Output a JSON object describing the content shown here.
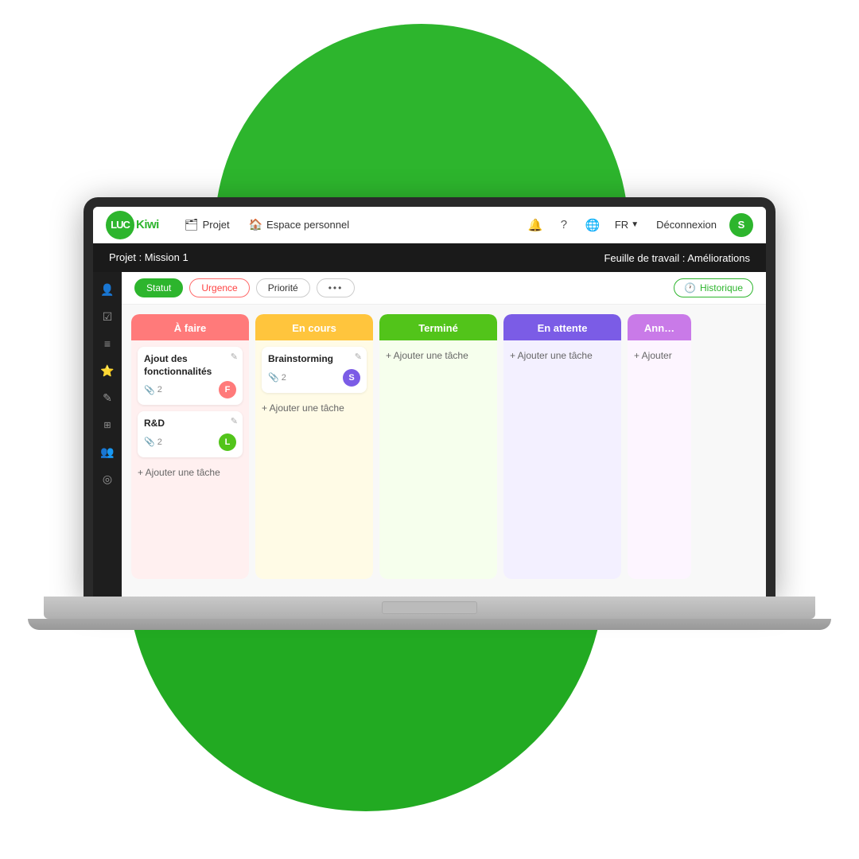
{
  "scene": {
    "logo": {
      "text_luc": "LUC",
      "text_kiwi": "Kiwi",
      "full": "LUCKiwi"
    },
    "navbar": {
      "projet_label": "Projet",
      "espace_label": "Espace personnel",
      "lang": "FR",
      "deconnexion": "Déconnexion",
      "user_initial": "S"
    },
    "project_header": {
      "left": "Projet : Mission 1",
      "right": "Feuille de travail : Améliorations"
    },
    "filter_bar": {
      "statut": "Statut",
      "urgence": "Urgence",
      "priorite": "Priorité",
      "more": "•••",
      "historique": "Historique"
    },
    "columns": [
      {
        "id": "a-faire",
        "header": "À faire",
        "header_class": "a-faire",
        "body_class": "a-faire",
        "tasks": [
          {
            "title": "Ajout des fonctionnalités",
            "attachments": 2,
            "avatar": "F",
            "avatar_class": "avatar-f"
          },
          {
            "title": "R&D",
            "attachments": 2,
            "avatar": "L",
            "avatar_class": "avatar-l"
          }
        ],
        "add_label": "+ Ajouter une tâche"
      },
      {
        "id": "en-cours",
        "header": "En cours",
        "header_class": "en-cours",
        "body_class": "en-cours",
        "tasks": [
          {
            "title": "Brainstorming",
            "attachments": 2,
            "avatar": "S",
            "avatar_class": "avatar-s"
          }
        ],
        "add_label": "+ Ajouter une tâche"
      },
      {
        "id": "termine",
        "header": "Terminé",
        "header_class": "termine",
        "body_class": "termine",
        "tasks": [],
        "add_label": "+ Ajouter une tâche"
      },
      {
        "id": "en-attente",
        "header": "En attente",
        "header_class": "en-attente",
        "body_class": "en-attente",
        "tasks": [],
        "add_label": "+ Ajouter une tâche"
      },
      {
        "id": "annule",
        "header": "Ann…",
        "header_class": "annule",
        "body_class": "annule",
        "tasks": [],
        "add_label": "+ Ajouter"
      }
    ],
    "sidebar_icons": [
      "👤",
      "☑",
      "≡",
      "⭐",
      "✎",
      "⚙",
      "👥",
      "◎"
    ]
  }
}
